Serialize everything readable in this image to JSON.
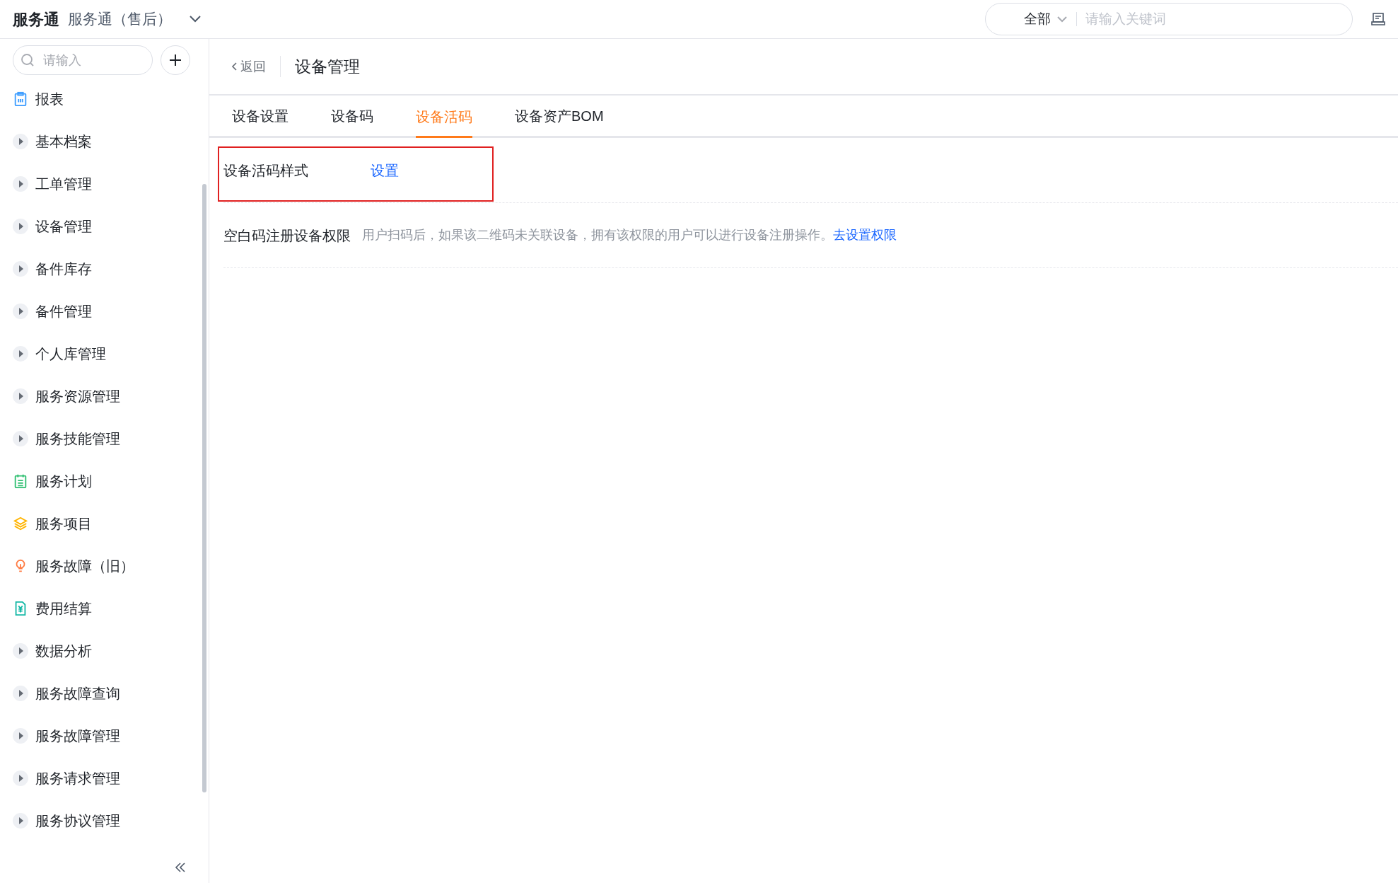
{
  "top_bar": {
    "brand": "服务通",
    "app_name": "服务通（售后）",
    "scope": "全部",
    "search": {
      "placeholder": "请输入关键词"
    }
  },
  "sidebar": {
    "search": {
      "placeholder": "请输入"
    },
    "items": [
      {
        "label": "报表",
        "kind": "page",
        "color": "#3b9cff"
      },
      {
        "label": "基本档案",
        "kind": "group"
      },
      {
        "label": "工单管理",
        "kind": "group"
      },
      {
        "label": "设备管理",
        "kind": "group"
      },
      {
        "label": "备件库存",
        "kind": "group"
      },
      {
        "label": "备件管理",
        "kind": "group"
      },
      {
        "label": "个人库管理",
        "kind": "group"
      },
      {
        "label": "服务资源管理",
        "kind": "group"
      },
      {
        "label": "服务技能管理",
        "kind": "group"
      },
      {
        "label": "服务计划",
        "kind": "page",
        "color": "#2fbf71"
      },
      {
        "label": "服务项目",
        "kind": "page",
        "color": "#ffb400"
      },
      {
        "label": "服务故障（旧）",
        "kind": "page",
        "color": "#ff7d45"
      },
      {
        "label": "费用结算",
        "kind": "page",
        "color": "#14b8a6"
      },
      {
        "label": "数据分析",
        "kind": "group"
      },
      {
        "label": "服务故障查询",
        "kind": "group"
      },
      {
        "label": "服务故障管理",
        "kind": "group"
      },
      {
        "label": "服务请求管理",
        "kind": "group"
      },
      {
        "label": "服务协议管理",
        "kind": "group"
      }
    ]
  },
  "header": {
    "back": "返回",
    "title": "设备管理"
  },
  "tabs": [
    {
      "label": "设备设置",
      "selected": false
    },
    {
      "label": "设备码",
      "selected": false
    },
    {
      "label": "设备活码",
      "selected": true
    },
    {
      "label": "设备资产BOM",
      "selected": false
    }
  ],
  "settings": [
    {
      "label": "设备活码样式",
      "link": "设置",
      "highlighted": true
    },
    {
      "label": "空白码注册设备权限",
      "description": "用户扫码后，如果该二维码未关联设备，拥有该权限的用户可以进行设备注册操作。",
      "link": "去设置权限",
      "highlighted": false
    }
  ]
}
